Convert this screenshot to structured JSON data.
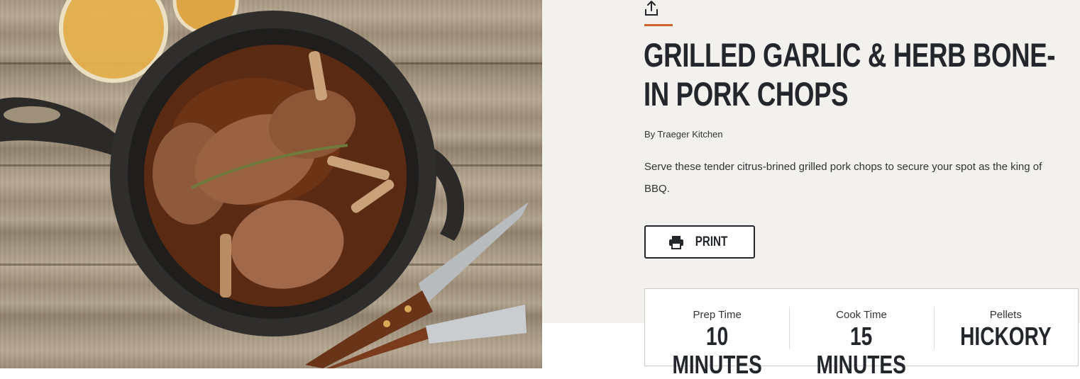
{
  "recipe": {
    "title": "GRILLED GARLIC & HERB BONE-IN PORK CHOPS",
    "byline": "By Traeger Kitchen",
    "description": "Serve these tender citrus-brined grilled pork chops to secure your spot as the king of BBQ.",
    "print_label": "PRINT",
    "accent_color": "#d3612b"
  },
  "icons": {
    "share": "share-icon",
    "print": "printer-icon"
  },
  "stats": [
    {
      "label": "Prep Time",
      "value": "10 MINUTES"
    },
    {
      "label": "Cook Time",
      "value": "15 MINUTES"
    },
    {
      "label": "Pellets",
      "value": "HICKORY"
    }
  ]
}
